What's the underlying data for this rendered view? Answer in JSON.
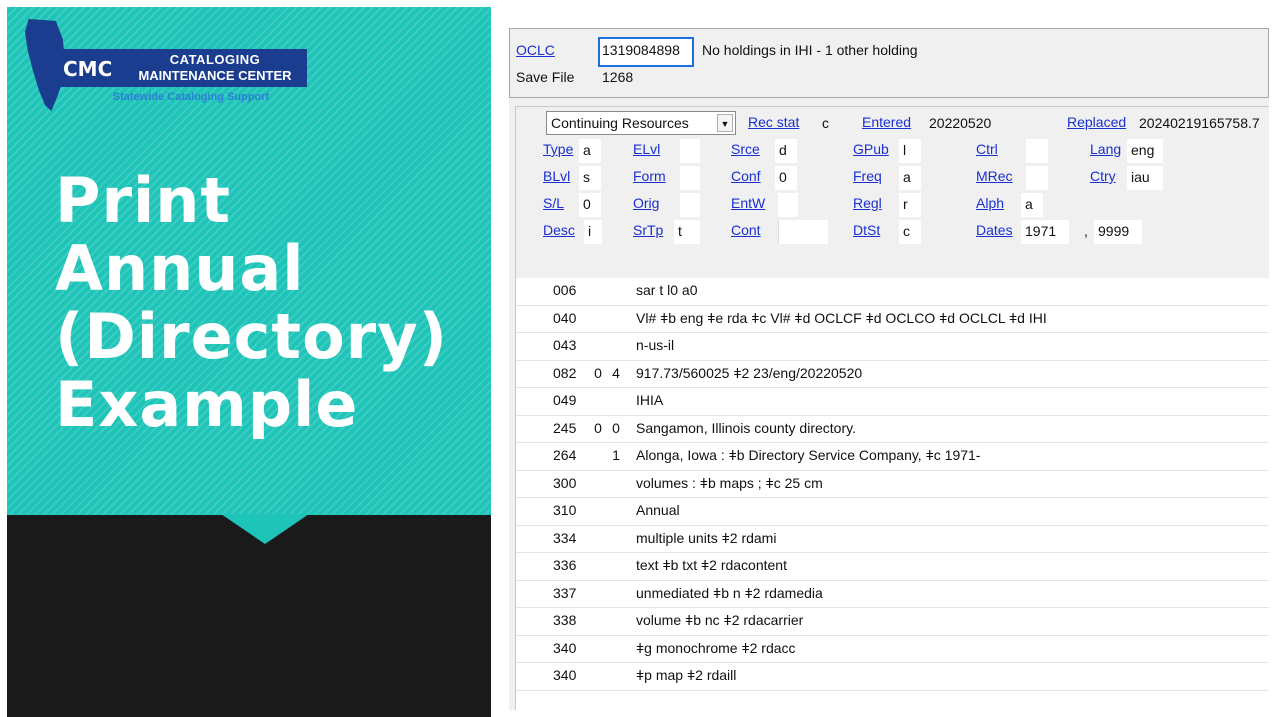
{
  "slide": {
    "title_lines": [
      "Print",
      "Annual",
      "(Directory)",
      "Example"
    ],
    "logo": {
      "abbr": "CMC",
      "line1": "CATALOGING",
      "line2": "MAINTENANCE CENTER",
      "subtitle": "Statewide Cataloging Support"
    },
    "colors": {
      "teal": "#1fc4b8",
      "dark": "#1a1a1a",
      "logo_blue": "#1a3d8f"
    }
  },
  "record": {
    "oclc_label": "OCLC",
    "oclc_number": "1319084898",
    "holdings": "No holdings in IHI - 1 other holding",
    "save_file_label": "Save File",
    "save_file_number": "1268",
    "format_select": "Continuing Resources",
    "rec_stat": {
      "label": "Rec stat",
      "value": "c"
    },
    "entered": {
      "label": "Entered",
      "value": "20220520"
    },
    "replaced": {
      "label": "Replaced",
      "value": "20240219165758.7"
    },
    "fixed_fields": [
      {
        "label": "Type",
        "value": "a"
      },
      {
        "label": "ELvl",
        "value": ""
      },
      {
        "label": "Srce",
        "value": "d"
      },
      {
        "label": "GPub",
        "value": "l"
      },
      {
        "label": "Ctrl",
        "value": ""
      },
      {
        "label": "Lang",
        "value": "eng"
      },
      {
        "label": "BLvl",
        "value": "s"
      },
      {
        "label": "Form",
        "value": ""
      },
      {
        "label": "Conf",
        "value": "0"
      },
      {
        "label": "Freq",
        "value": "a"
      },
      {
        "label": "MRec",
        "value": ""
      },
      {
        "label": "Ctry",
        "value": "iau"
      },
      {
        "label": "S/L",
        "value": "0"
      },
      {
        "label": "Orig",
        "value": ""
      },
      {
        "label": "EntW",
        "value": ""
      },
      {
        "label": "Regl",
        "value": "r"
      },
      {
        "label": "Alph",
        "value": "a"
      },
      {
        "label": "Desc",
        "value": "i"
      },
      {
        "label": "SrTp",
        "value": "t"
      },
      {
        "label": "Cont",
        "value": ""
      },
      {
        "label": "DtSt",
        "value": "c"
      },
      {
        "label": "Dates",
        "value": "1971"
      },
      {
        "label": "dates_sep",
        "value": ","
      },
      {
        "label": "dates_end",
        "value": "9999"
      }
    ],
    "fields": [
      {
        "tag": "006",
        "i1": "",
        "i2": "",
        "data": "sar t    l0  a0"
      },
      {
        "tag": "040",
        "i1": "",
        "i2": "",
        "data": "Vl# ǂb eng ǂe rda ǂc Vl# ǂd OCLCF ǂd OCLCO ǂd OCLCL ǂd IHI"
      },
      {
        "tag": "043",
        "i1": "",
        "i2": "",
        "data": "n-us-il"
      },
      {
        "tag": "082",
        "i1": "0",
        "i2": "4",
        "data": "917.73/560025 ǂ2 23/eng/20220520"
      },
      {
        "tag": "049",
        "i1": "",
        "i2": "",
        "data": "IHIA"
      },
      {
        "tag": "245",
        "i1": "0",
        "i2": "0",
        "data": "Sangamon, Illinois county directory."
      },
      {
        "tag": "264",
        "i1": "",
        "i2": "1",
        "data": "Alonga, Iowa : ǂb Directory Service Company, ǂc 1971-"
      },
      {
        "tag": "300",
        "i1": "",
        "i2": "",
        "data": "volumes : ǂb maps ; ǂc 25 cm"
      },
      {
        "tag": "310",
        "i1": "",
        "i2": "",
        "data": "Annual"
      },
      {
        "tag": "334",
        "i1": "",
        "i2": "",
        "data": "multiple units ǂ2 rdami"
      },
      {
        "tag": "336",
        "i1": "",
        "i2": "",
        "data": "text ǂb txt ǂ2 rdacontent"
      },
      {
        "tag": "337",
        "i1": "",
        "i2": "",
        "data": "unmediated ǂb n ǂ2 rdamedia"
      },
      {
        "tag": "338",
        "i1": "",
        "i2": "",
        "data": "volume ǂb nc ǂ2 rdacarrier"
      },
      {
        "tag": "340",
        "i1": "",
        "i2": "",
        "data": "ǂg monochrome ǂ2 rdacc"
      },
      {
        "tag": "340",
        "i1": "",
        "i2": "",
        "data": "ǂp map ǂ2 rdaill"
      }
    ]
  }
}
